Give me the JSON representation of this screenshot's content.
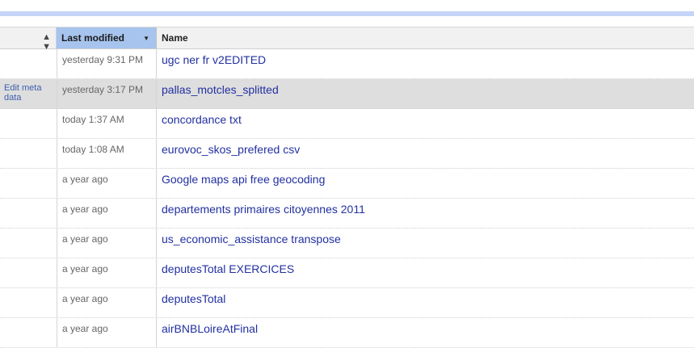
{
  "header": {
    "modified_label": "Last modified",
    "name_label": "Name"
  },
  "rows": [
    {
      "action": "",
      "modified": "yesterday 9:31 PM",
      "name": "ugc ner fr v2EDITED"
    },
    {
      "action": "Edit meta data",
      "modified": "yesterday 3:17 PM",
      "name": "pallas_motcles_splitted"
    },
    {
      "action": "",
      "modified": "today 1:37 AM",
      "name": "concordance txt"
    },
    {
      "action": "",
      "modified": "today 1:08 AM",
      "name": "eurovoc_skos_prefered csv"
    },
    {
      "action": "",
      "modified": "a year ago",
      "name": "Google maps api free geocoding"
    },
    {
      "action": "",
      "modified": "a year ago",
      "name": "departements primaires citoyennes 2011"
    },
    {
      "action": "",
      "modified": "a year ago",
      "name": "us_economic_assistance transpose"
    },
    {
      "action": "",
      "modified": "a year ago",
      "name": "deputesTotal EXERCICES"
    },
    {
      "action": "",
      "modified": "a year ago",
      "name": "deputesTotal"
    },
    {
      "action": "",
      "modified": "a year ago",
      "name": "airBNBLoireAtFinal"
    }
  ],
  "icons": {
    "sort": "sort-updown-icon",
    "caret": "caret-down-icon"
  }
}
